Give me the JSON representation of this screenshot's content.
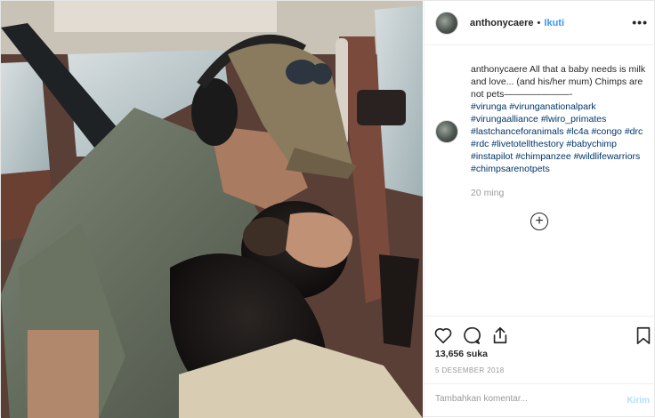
{
  "post": {
    "username": "anthonycaere",
    "separator": "•",
    "follow_label": "Ikuti",
    "more_label": "•••",
    "caption": {
      "username": "anthonycaere",
      "text": "All that a baby needs is milk and love... (and his/her mum) Chimps are not pets———————-",
      "hashtags": [
        "#virunga",
        "#virunganationalpark",
        "#virungaalliance",
        "#lwiro_primates",
        "#lastchanceforanimals",
        "#lc4a",
        "#congo",
        "#drc",
        "#rdc",
        "#livetotellthestory",
        "#babychimp",
        "#instapilot",
        "#chimpanzee",
        "#wildlifewarriors",
        "#chimpsarenotpets"
      ]
    },
    "time_ago": "20 ming",
    "load_more": "+",
    "likes": "13,656 suka",
    "date": "5 DESEMBER 2018",
    "comment": {
      "placeholder": "Tambahkan komentar...",
      "submit_label": "Kirim"
    },
    "icons": {
      "like": "heart-icon",
      "comment": "comment-icon",
      "share": "share-icon",
      "save": "bookmark-icon"
    }
  }
}
